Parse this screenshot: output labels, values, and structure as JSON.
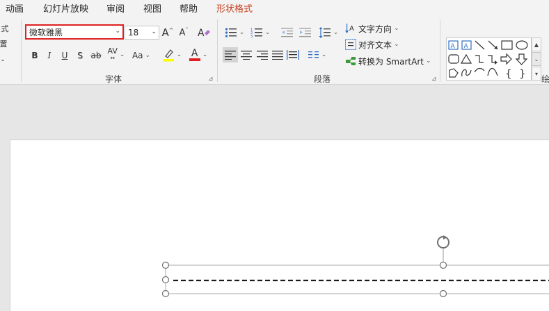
{
  "tabs": [
    {
      "label": "动画",
      "active": false
    },
    {
      "label": "幻灯片放映",
      "active": false
    },
    {
      "label": "审阅",
      "active": false
    },
    {
      "label": "视图",
      "active": false
    },
    {
      "label": "帮助",
      "active": false
    },
    {
      "label": "形状格式",
      "active": true
    }
  ],
  "font": {
    "font_name": "微软雅黑",
    "font_size": "18",
    "grow_label": "A",
    "shrink_label": "A",
    "bold": "B",
    "italic": "I",
    "underline": "U",
    "shadow": "S",
    "strikethrough": "ab",
    "spacing": "AV",
    "change_case": "Aa",
    "font_color_letter": "A",
    "group_label": "字体"
  },
  "paragraph": {
    "text_direction": "文字方向",
    "align_text": "对齐文本",
    "convert_smartart": "转换为 SmartArt",
    "group_label": "段落"
  },
  "drawing": {
    "group_label_partial": "绘"
  },
  "left_edge": {
    "glyph1": "式",
    "glyph2": "置"
  },
  "colors": {
    "accent": "#c43e1c",
    "highlight_bar": "#ffff00",
    "font_color_bar": "#e02020",
    "selection_box": "#e02020"
  }
}
